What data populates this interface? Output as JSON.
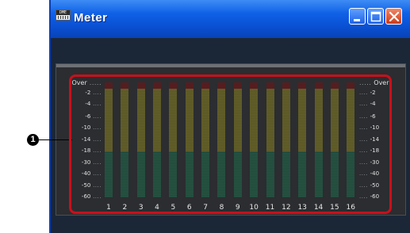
{
  "window": {
    "title": "Meter",
    "app_icon": "dme-app-icon",
    "app_icon_text": "DME",
    "controls": [
      "minimize-icon",
      "maximize-icon",
      "close-icon"
    ]
  },
  "scale_left": [
    "Over",
    "-2",
    "-4",
    "-6",
    "-10",
    "-14",
    "-18",
    "-30",
    "-40",
    "-50",
    "-60"
  ],
  "scale_right": [
    "Over",
    "-2",
    "-4",
    "-6",
    "-10",
    "-14",
    "-18",
    "-30",
    "-40",
    "-50",
    "-60"
  ],
  "channels": [
    "1",
    "2",
    "3",
    "4",
    "5",
    "6",
    "7",
    "8",
    "9",
    "10",
    "11",
    "12",
    "13",
    "14",
    "15",
    "16"
  ],
  "callout": {
    "number": "1"
  },
  "colors": {
    "title_bar": "#0a52d6",
    "meter_red": "#561d20",
    "meter_yellow": "#66622a",
    "meter_green": "#275545",
    "highlight": "#c8101c"
  }
}
